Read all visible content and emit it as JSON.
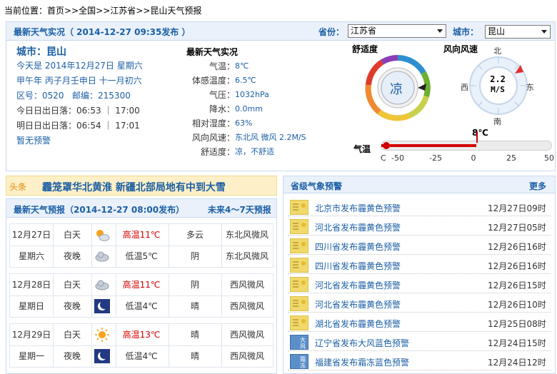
{
  "breadcrumb": {
    "label": "当前位置：",
    "home": "首页",
    "sep": ">>",
    "nation": "全国",
    "province": "江苏省",
    "page": "昆山天气预报"
  },
  "live": {
    "header": "最新天气实况（ 2014-12-27  09:35发布 ）",
    "province_label": "省份：",
    "province_value": "江苏省",
    "city_label": "城市：",
    "city_value": "昆山",
    "city_title": "城市：昆山",
    "today_line": "今天是 2014年12月27日 星期六",
    "lunar_line": "甲午年 丙子月壬申日 十一月初六",
    "area_code_label": "区号：",
    "area_code": "0520",
    "zip_label": "邮编：",
    "zip": "215300",
    "sun_today": "今日日出日落：06:53 ｜ 17:00",
    "sun_tomorrow": "明日日出日落：06:54 ｜ 17:01",
    "no_warning": "暂无预警",
    "obs_title": "最新天气实况",
    "obs": [
      {
        "label": "气温：",
        "value": "8℃"
      },
      {
        "label": "体感温度：",
        "value": "6.5℃"
      },
      {
        "label": "气压：",
        "value": "1032hPa"
      },
      {
        "label": "降水：",
        "value": "0.0mm"
      },
      {
        "label": "相对湿度：",
        "value": "63%"
      },
      {
        "label": "风向风速：",
        "value": "东北风 微风 2.2M/S"
      },
      {
        "label": "舒适度：",
        "value": "凉，不舒适"
      }
    ],
    "comfort_title": "舒适度",
    "comfort_value": "凉",
    "wind_title": "风向风速",
    "wind_speed": "2.2",
    "wind_unit": "M/S",
    "compass": {
      "n": "北",
      "s": "南",
      "w": "西",
      "e": "东"
    },
    "temp_label": "气温",
    "temp_value": "8℃",
    "temp_ticks": [
      "-50",
      "-25",
      "0",
      "25",
      "50"
    ],
    "temp_unit": "C",
    "temp_data": {
      "value": 8,
      "min": -50,
      "max": 50
    }
  },
  "headline": {
    "tag": "头条",
    "text": "霾笼罩华北黄淮  新疆北部局地有中到大雪"
  },
  "forecast": {
    "header": "最新天气预报（2014-12-27  08:00发布）",
    "more": "未来4～7天预报",
    "days": [
      {
        "date": "12月27日",
        "weekday": "星期六",
        "day": {
          "label": "白天",
          "icon": "partly-cloudy-icon",
          "temp": "高温11℃",
          "weather": "多云",
          "wind": "东北风微风"
        },
        "night": {
          "label": "夜晚",
          "icon": "cloud-icon",
          "temp": "低温5℃",
          "weather": "阴",
          "wind": "东北风微风"
        }
      },
      {
        "date": "12月28日",
        "weekday": "星期日",
        "day": {
          "label": "白天",
          "icon": "cloud-icon",
          "temp": "高温11℃",
          "weather": "阴",
          "wind": "西风微风"
        },
        "night": {
          "label": "夜晚",
          "icon": "moon-icon",
          "temp": "低温4℃",
          "weather": "晴",
          "wind": "西风微风"
        }
      },
      {
        "date": "12月29日",
        "weekday": "星期一",
        "day": {
          "label": "白天",
          "icon": "sun-icon",
          "temp": "高温13℃",
          "weather": "晴",
          "wind": "西风微风"
        },
        "night": {
          "label": "夜晚",
          "icon": "moon-icon",
          "temp": "低温4℃",
          "weather": "晴",
          "wind": "西风微风"
        }
      }
    ]
  },
  "warnings": {
    "header": "省级气象预警",
    "more": "更多",
    "items": [
      {
        "text": "北京市发布霾黄色预警",
        "time": "12月27日09时",
        "icon": "haze-yellow-icon"
      },
      {
        "text": "河北省发布霾黄色预警",
        "time": "12月27日05时",
        "icon": "haze-yellow-icon"
      },
      {
        "text": "四川省发布霾黄色预警",
        "time": "12月26日16时",
        "icon": "haze-yellow-icon"
      },
      {
        "text": "四川省发布霾黄色预警",
        "time": "12月26日16时",
        "icon": "haze-yellow-icon"
      },
      {
        "text": "河北省发布霾黄色预警",
        "time": "12月26日15时",
        "icon": "haze-yellow-icon"
      },
      {
        "text": "河北省发布霾黄色预警",
        "time": "12月26日10时",
        "icon": "haze-yellow-icon"
      },
      {
        "text": "湖北省发布霾黄色预警",
        "time": "12月25日08时",
        "icon": "haze-yellow-icon"
      },
      {
        "text": "辽宁省发布大风蓝色预警",
        "time": "12月24日15时",
        "icon": "wind-blue-icon",
        "icon_text": "大风"
      },
      {
        "text": "福建省发布霜冻蓝色预警",
        "time": "12月24日12时",
        "icon": "frost-blue-icon",
        "icon_text": "霜冻"
      }
    ]
  },
  "colors": {
    "accent": "#1b5fa5",
    "red": "#d40000",
    "panel": "#eaf1fb",
    "headline_bg": "#fdf0c8",
    "haze_yellow": "#f0d86a",
    "warn_blue": "#5b8fc9"
  }
}
